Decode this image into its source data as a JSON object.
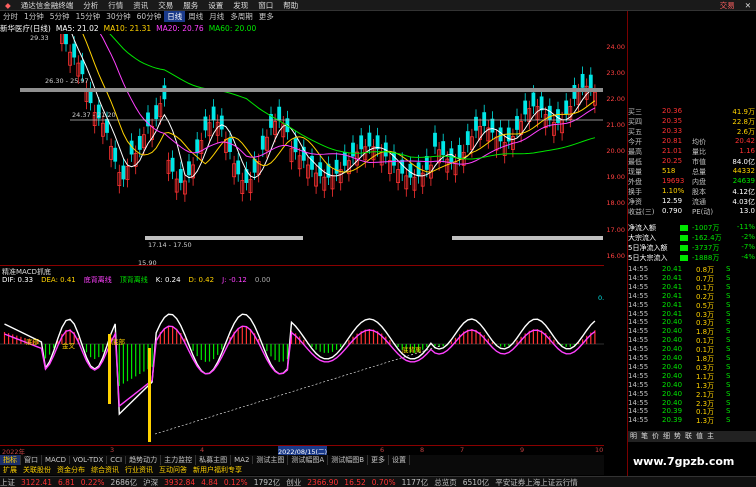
{
  "menu": [
    "分析",
    "行情",
    "资讯",
    "交易",
    "服务",
    "设置",
    "发现",
    "窗口",
    "帮助"
  ],
  "window_title": "通达信金融终端",
  "trade_label": "交易",
  "periods": [
    "分时",
    "1分钟",
    "5分钟",
    "15分钟",
    "30分钟",
    "60分钟",
    "日线",
    "周线",
    "月线",
    "多周期",
    "更多"
  ],
  "active_period": "日线",
  "stock_label": "新华医疗(日线)",
  "ma": [
    {
      "t": "MA5: 21.02",
      "c": "#ffffff"
    },
    {
      "t": "MA10: 21.31",
      "c": "#ffd200"
    },
    {
      "t": "MA20: 20.76",
      "c": "#ff40ff"
    },
    {
      "t": "MA60: 20.00",
      "c": "#00e600"
    }
  ],
  "price_axis": [
    "24.00",
    "23.00",
    "22.00",
    "21.00",
    "20.00",
    "19.00",
    "18.00",
    "17.00",
    "16.00"
  ],
  "chart_notes": {
    "high": "29.33",
    "band1": "26.30 - 25.97",
    "band2": "24.37 - 21.20",
    "band3": "17.14 - 17.50",
    "low": "15.90"
  },
  "indicator": {
    "name": "精准MACD抓底",
    "dif": "DIF: 0.33",
    "dea": "DEA: 0.41",
    "bottom": "底背离线",
    "tag": "顶背离线",
    "k": "K: 0.24",
    "d": "D: 0.42",
    "j": "J: -0.12",
    "extra": "0.00"
  },
  "macd_labels": [
    "底部",
    "底部",
    "金叉",
    "底背离",
    "0.82"
  ],
  "macd_axis": [
    "0.82",
    "-1.00"
  ],
  "xaxis": [
    "2022年",
    "3",
    "4",
    "5",
    "6",
    "7",
    "2022/08/15(二)",
    "8",
    "9",
    "10"
  ],
  "tabs1": [
    "指标",
    "窗口",
    "MACD",
    "VOL-TDX",
    "CCI",
    "趋势动力",
    "主力监控",
    "私募主图",
    "MA2",
    "测试主图",
    "测试幅图A",
    "测试幅图B",
    "更多",
    "设置"
  ],
  "tabs1_active": "指标",
  "tabs2": [
    "扩展",
    "关联股份",
    "资金分布",
    "综合资讯",
    "行业资讯",
    "互动问答",
    "新用户福利专享"
  ],
  "status": [
    {
      "t": "上证",
      "c": "#c0c0c0"
    },
    {
      "t": "3122.41",
      "c": "#ff3232"
    },
    {
      "t": "6.81",
      "c": "#ff3232"
    },
    {
      "t": "0.22%",
      "c": "#ff3232"
    },
    {
      "t": "2686亿",
      "c": "#c0c0c0"
    },
    {
      "t": "沪深",
      "c": "#c0c0c0"
    },
    {
      "t": "3932.84",
      "c": "#ff3232"
    },
    {
      "t": "4.84",
      "c": "#ff3232"
    },
    {
      "t": "0.12%",
      "c": "#ff3232"
    },
    {
      "t": "1792亿",
      "c": "#c0c0c0"
    },
    {
      "t": "创业",
      "c": "#c0c0c0"
    },
    {
      "t": "2366.90",
      "c": "#ff3232"
    },
    {
      "t": "16.52",
      "c": "#ff3232"
    },
    {
      "t": "0.70%",
      "c": "#ff3232"
    },
    {
      "t": "1177亿",
      "c": "#c0c0c0"
    },
    {
      "t": "总览页",
      "c": "#c0c0c0"
    },
    {
      "t": "6510亿",
      "c": "#c0c0c0"
    },
    {
      "t": "平安证券上海上证云行情",
      "c": "#c0c0c0"
    }
  ],
  "quotes": [
    {
      "k": "买三",
      "v": "20.36",
      "c": "#ff3232",
      "v2": "41.9万",
      "c2": "#ffd200"
    },
    {
      "k": "买四",
      "v": "20.35",
      "c": "#ff3232",
      "v2": "22.8万",
      "c2": "#ffd200"
    },
    {
      "k": "买五",
      "v": "20.33",
      "c": "#ff3232",
      "v2": "2.6万",
      "c2": "#ffd200"
    },
    {
      "k": "今开",
      "v": "20.81",
      "c": "#ff3232",
      "k2": "均价",
      "v2": "20.42",
      "c2": "#ff3232"
    },
    {
      "k": "最高",
      "v": "21.01",
      "c": "#ff3232",
      "k2": "量比",
      "v2": "1.16",
      "c2": "#ff3232"
    },
    {
      "k": "最低",
      "v": "20.25",
      "c": "#ff3232",
      "k2": "市值",
      "v2": "84.0亿",
      "c2": "#ffffff"
    },
    {
      "k": "现量",
      "v": "518",
      "c": "#ffd200",
      "k2": "总量",
      "v2": "44332",
      "c2": "#ffd200"
    },
    {
      "k": "外盘",
      "v": "19693",
      "c": "#ff3232",
      "k2": "内盘",
      "v2": "24639",
      "c2": "#00e600"
    },
    {
      "k": "换手",
      "v": "1.10%",
      "c": "#ffd200",
      "k2": "股本",
      "v2": "4.12亿",
      "c2": "#ffffff"
    },
    {
      "k": "净资",
      "v": "12.59",
      "c": "#ffffff",
      "k2": "流通",
      "v2": "4.03亿",
      "c2": "#ffffff"
    },
    {
      "k": "收益(三)",
      "v": "0.790",
      "c": "#ffffff",
      "k2": "PE(动)",
      "v2": "13.0",
      "c2": "#ffffff"
    }
  ],
  "flows": [
    {
      "k": "净流入额",
      "v": "-1007万",
      "r": "-11%"
    },
    {
      "k": "大宗流入",
      "v": "-162.4万",
      "r": "-2%"
    },
    {
      "k": "5日净流入额",
      "v": "-3737万",
      "r": "-7%"
    },
    {
      "k": "5日大宗流入",
      "v": "-1888万",
      "r": "-4%"
    }
  ],
  "ticks": [
    {
      "t": "14:55",
      "p": "20.41",
      "v": "0.8万",
      "d": "S"
    },
    {
      "t": "14:55",
      "p": "20.41",
      "v": "0.7万",
      "d": "S"
    },
    {
      "t": "14:55",
      "p": "20.41",
      "v": "0.1万",
      "d": "S"
    },
    {
      "t": "14:55",
      "p": "20.41",
      "v": "0.2万",
      "d": "S"
    },
    {
      "t": "14:55",
      "p": "20.41",
      "v": "0.5万",
      "d": "S"
    },
    {
      "t": "14:55",
      "p": "20.41",
      "v": "0.3万",
      "d": "S"
    },
    {
      "t": "14:55",
      "p": "20.40",
      "v": "0.3万",
      "d": "S"
    },
    {
      "t": "14:55",
      "p": "20.40",
      "v": "1.8万",
      "d": "S"
    },
    {
      "t": "14:55",
      "p": "20.40",
      "v": "0.1万",
      "d": "S"
    },
    {
      "t": "14:55",
      "p": "20.40",
      "v": "0.1万",
      "d": "S"
    },
    {
      "t": "14:55",
      "p": "20.40",
      "v": "1.8万",
      "d": "S"
    },
    {
      "t": "14:55",
      "p": "20.40",
      "v": "0.3万",
      "d": "S"
    },
    {
      "t": "14:55",
      "p": "20.40",
      "v": "1.1万",
      "d": "S"
    },
    {
      "t": "14:55",
      "p": "20.40",
      "v": "1.3万",
      "d": "S"
    },
    {
      "t": "14:55",
      "p": "20.40",
      "v": "2.1万",
      "d": "S"
    },
    {
      "t": "14:55",
      "p": "20.40",
      "v": "2.3万",
      "d": "S"
    },
    {
      "t": "14:55",
      "p": "20.39",
      "v": "0.1万",
      "d": "S"
    },
    {
      "t": "14:55",
      "p": "20.39",
      "v": "1.3万",
      "d": "S"
    }
  ],
  "right_tabs": [
    "明",
    "笔",
    "价",
    "细",
    "势",
    "联",
    "值",
    "主"
  ],
  "watermark": "www.7gpzb.com"
}
